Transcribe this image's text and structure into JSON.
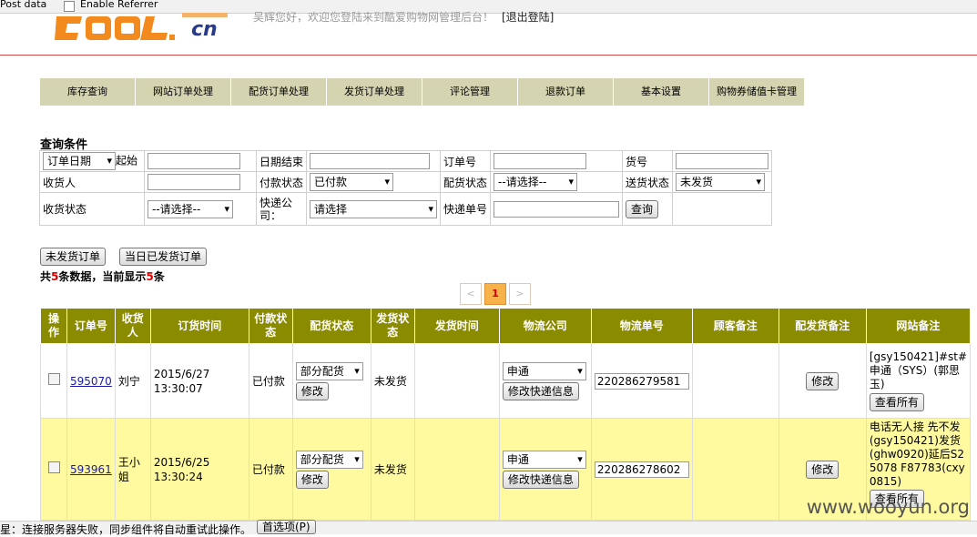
{
  "toolbar": {
    "post_data": "Post data",
    "enable_referrer": "Enable Referrer"
  },
  "header": {
    "logo_text": "cn",
    "welcome": "吴辉您好，欢迎您登陆来到酷爱购物网管理后台！",
    "logout": "[退出登陆]"
  },
  "nav": [
    "库存查询",
    "网站订单处理",
    "配货订单处理",
    "发货订单处理",
    "评论管理",
    "退款订单",
    "基本设置",
    "购物券储值卡管理"
  ],
  "query": {
    "title": "查询条件",
    "date_type": "订单日期",
    "start_label": "起始",
    "end_label": "日期结束",
    "order_no_label": "订单号",
    "sku_label": "货号",
    "receiver_label": "收货人",
    "pay_status_label": "付款状态",
    "pay_status_value": "已付款",
    "alloc_status_label": "配货状态",
    "alloc_status_value": "--请选择--",
    "ship_status_label": "送货状态",
    "ship_status_value": "未发货",
    "recv_status_label": "收货状态",
    "recv_status_value": "--请选择--",
    "courier_label_1": "快递公",
    "courier_label_2": "司：",
    "courier_value": "请选择",
    "tracking_label": "快递单号",
    "search_button": "查询"
  },
  "actions": {
    "unshipped": "未发货订单",
    "today_shipped": "当日已发货订单"
  },
  "summary": {
    "prefix": "共",
    "total": "5",
    "middle": "条数据，当前显示",
    "shown": "5",
    "suffix": "条"
  },
  "pager": {
    "prev": "<",
    "current": "1",
    "next": ">"
  },
  "table": {
    "headers": {
      "op1": "操",
      "op2": "作",
      "order_no": "订单号",
      "receiver1": "收货",
      "receiver2": "人",
      "order_time": "订货时间",
      "pay1": "付款状",
      "pay2": "态",
      "alloc": "配货状态",
      "ship1": "发货状",
      "ship2": "态",
      "ship_time": "发货时间",
      "logistics": "物流公司",
      "tracking": "物流单号",
      "customer_note": "顾客备注",
      "alloc_note": "配发货备注",
      "site_note": "网站备注"
    },
    "rows": [
      {
        "order_no": "595070",
        "receiver": "刘宁",
        "date": "2015/6/27",
        "time": "13:30:07",
        "pay_status": "已付款",
        "alloc_status": "部分配货",
        "modify": "修改",
        "ship_status": "未发货",
        "logistics": "申通",
        "modify_courier": "修改快递信息",
        "tracking": "220286279581",
        "modify_note": "修改",
        "site_note": "[gsy150421]#st#申通（SYS）(郭思玉)",
        "view_all": "查看所有"
      },
      {
        "order_no": "593961",
        "receiver": "王小姐",
        "date": "2015/6/25",
        "time": "13:30:24",
        "pay_status": "已付款",
        "alloc_status": "部分配货",
        "modify": "修改",
        "ship_status": "未发货",
        "logistics": "申通",
        "modify_courier": "修改快递信息",
        "tracking": "220286278602",
        "modify_note": "修改",
        "site_note": "电话无人接 先不发(gsy150421)发货(ghw0920)延后S25078 F87783(cxy0815)",
        "view_all": "查看所有"
      }
    ]
  },
  "statusbar": {
    "message": "星：连接服务器失败，同步组件将自动重试此操作。",
    "button": "首选项(P)"
  },
  "watermark": "www.wooyun.org"
}
